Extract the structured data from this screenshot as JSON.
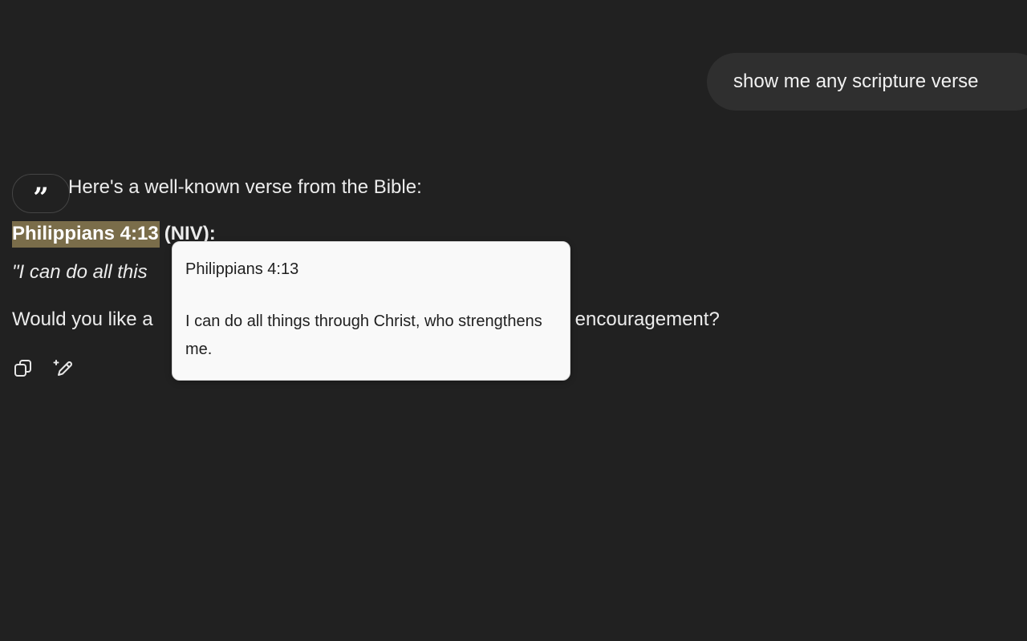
{
  "user_message": "show me any scripture verse",
  "assistant": {
    "intro": "Here's a well-known verse from the Bible:",
    "reference": "Philippians 4:13",
    "version": "(NIV):",
    "quote_visible": "\"I can do all this",
    "ask_visible_start": "Would you like a",
    "ask_visible_end": "r encouragement?"
  },
  "quote_button": {
    "symbol": "”",
    "icon": "quote-icon"
  },
  "actions": {
    "copy_icon": "copy-icon",
    "edit_icon": "edit-pen-icon"
  },
  "tooltip": {
    "title": "Philippians 4:13",
    "text": "I can do all things through Christ, who strengthens me."
  }
}
